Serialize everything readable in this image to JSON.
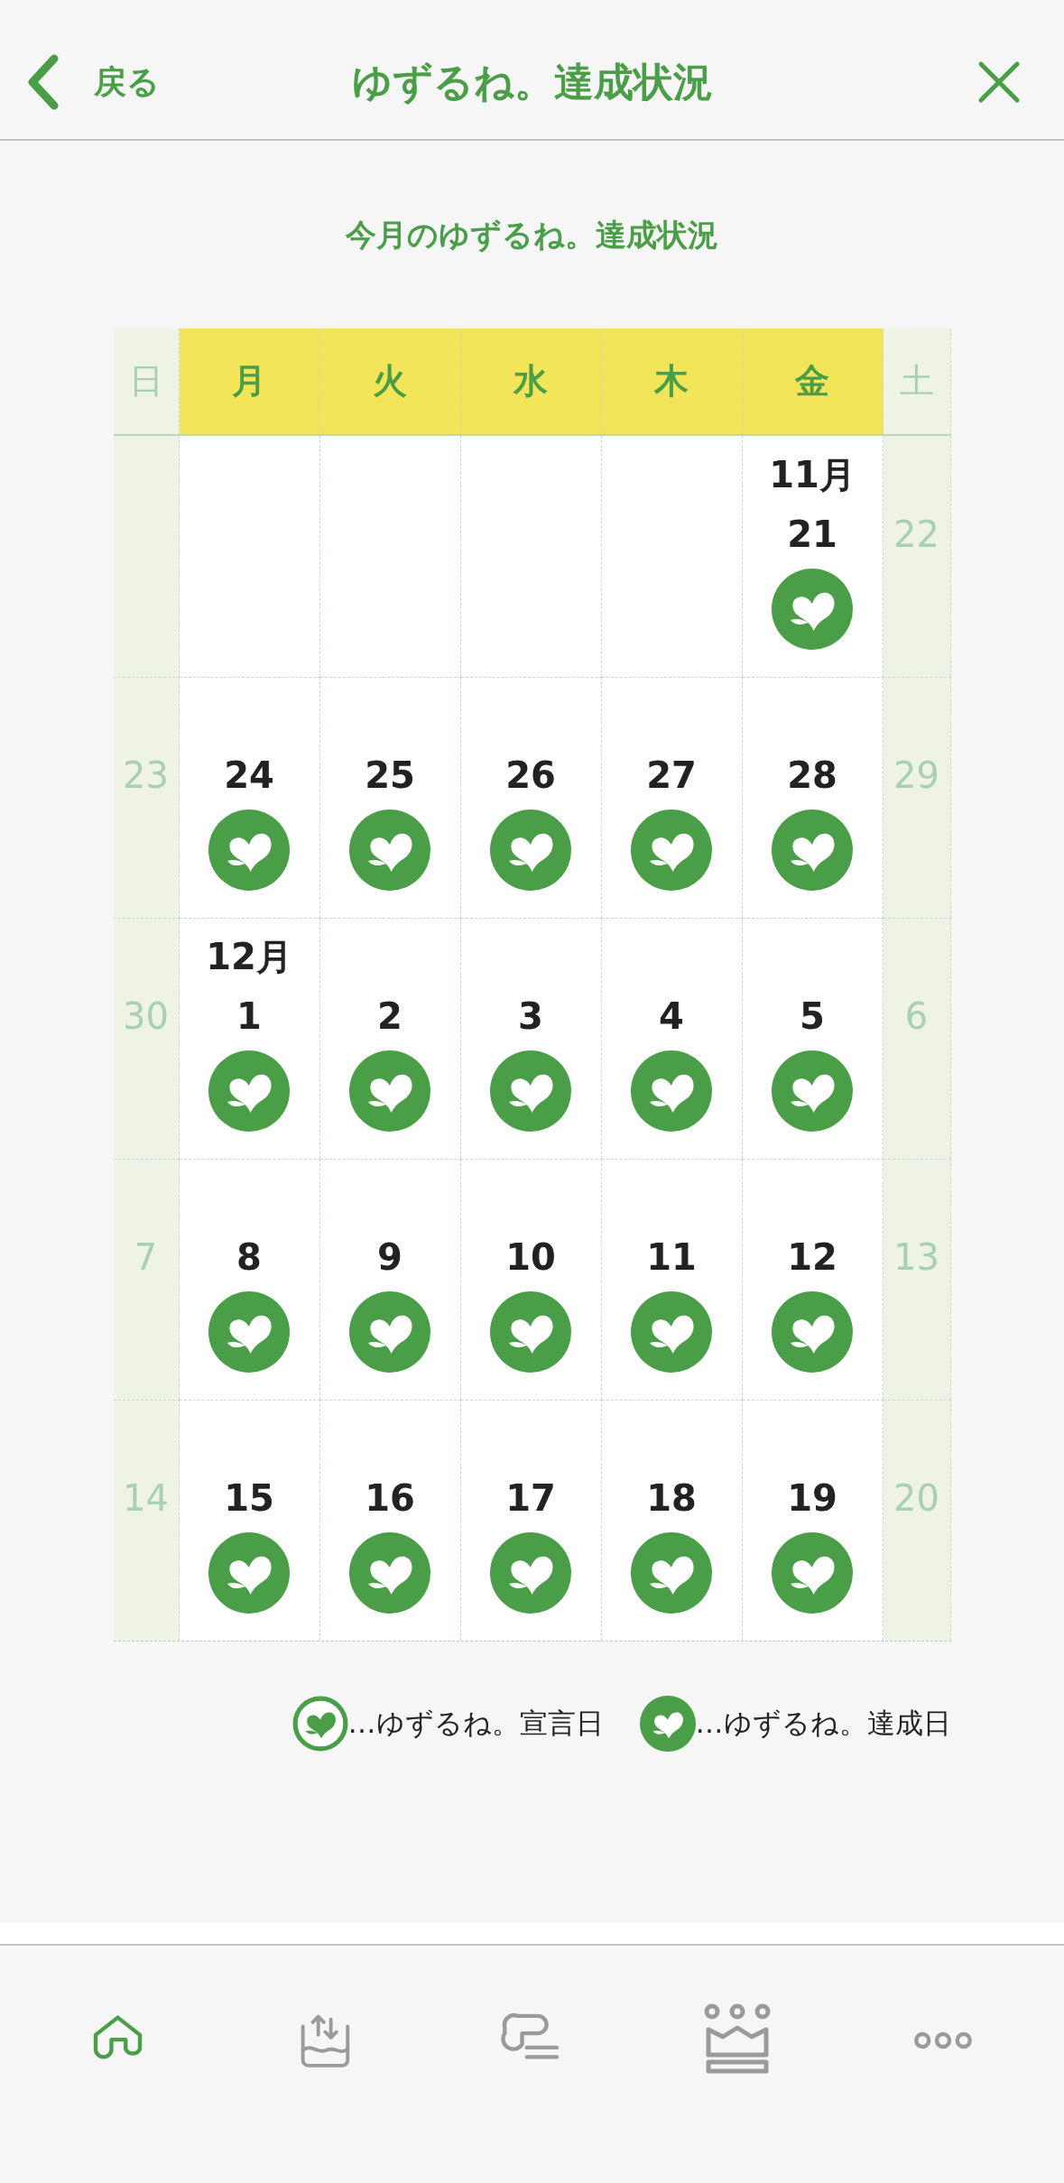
{
  "header": {
    "back_label": "戻る",
    "title": "ゆずるね。達成状況"
  },
  "subtitle": "今月のゆずるね。達成状況",
  "weekdays": [
    {
      "label": "日",
      "weekend": true
    },
    {
      "label": "月",
      "weekend": false
    },
    {
      "label": "火",
      "weekend": false
    },
    {
      "label": "水",
      "weekend": false
    },
    {
      "label": "木",
      "weekend": false
    },
    {
      "label": "金",
      "weekend": false
    },
    {
      "label": "土",
      "weekend": true
    }
  ],
  "weeks": [
    [
      {
        "kind": "blank"
      },
      {
        "kind": "blank"
      },
      {
        "kind": "blank"
      },
      {
        "kind": "blank"
      },
      {
        "kind": "blank"
      },
      {
        "kind": "date",
        "month": "11月",
        "day": "21",
        "achieved": true
      },
      {
        "kind": "date",
        "day": "22"
      }
    ],
    [
      {
        "kind": "date",
        "day": "23"
      },
      {
        "kind": "date",
        "day": "24",
        "achieved": true
      },
      {
        "kind": "date",
        "day": "25",
        "achieved": true
      },
      {
        "kind": "date",
        "day": "26",
        "achieved": true
      },
      {
        "kind": "date",
        "day": "27",
        "achieved": true
      },
      {
        "kind": "date",
        "day": "28",
        "achieved": true
      },
      {
        "kind": "date",
        "day": "29"
      }
    ],
    [
      {
        "kind": "date",
        "day": "30"
      },
      {
        "kind": "date",
        "month": "12月",
        "day": "1",
        "achieved": true
      },
      {
        "kind": "date",
        "day": "2",
        "achieved": true
      },
      {
        "kind": "date",
        "day": "3",
        "achieved": true
      },
      {
        "kind": "date",
        "day": "4",
        "achieved": true
      },
      {
        "kind": "date",
        "day": "5",
        "achieved": true
      },
      {
        "kind": "date",
        "day": "6"
      }
    ],
    [
      {
        "kind": "date",
        "day": "7"
      },
      {
        "kind": "date",
        "day": "8",
        "achieved": true
      },
      {
        "kind": "date",
        "day": "9",
        "achieved": true
      },
      {
        "kind": "date",
        "day": "10",
        "achieved": true
      },
      {
        "kind": "date",
        "day": "11",
        "achieved": true
      },
      {
        "kind": "date",
        "day": "12",
        "achieved": true
      },
      {
        "kind": "date",
        "day": "13"
      }
    ],
    [
      {
        "kind": "date",
        "day": "14"
      },
      {
        "kind": "date",
        "day": "15",
        "achieved": true
      },
      {
        "kind": "date",
        "day": "16",
        "achieved": true
      },
      {
        "kind": "date",
        "day": "17",
        "achieved": true
      },
      {
        "kind": "date",
        "day": "18",
        "achieved": true
      },
      {
        "kind": "date",
        "day": "19",
        "achieved": true
      },
      {
        "kind": "date",
        "day": "20"
      }
    ]
  ],
  "legend": [
    {
      "kind": "declared",
      "label": "…ゆずるね。宣言日"
    },
    {
      "kind": "achieved",
      "label": "…ゆずるね。達成日"
    }
  ],
  "tabs": [
    {
      "kind": "home",
      "selected": true
    },
    {
      "kind": "tray",
      "selected": false
    },
    {
      "kind": "chat",
      "selected": false
    },
    {
      "kind": "crown",
      "selected": false
    },
    {
      "kind": "more",
      "selected": false
    }
  ]
}
